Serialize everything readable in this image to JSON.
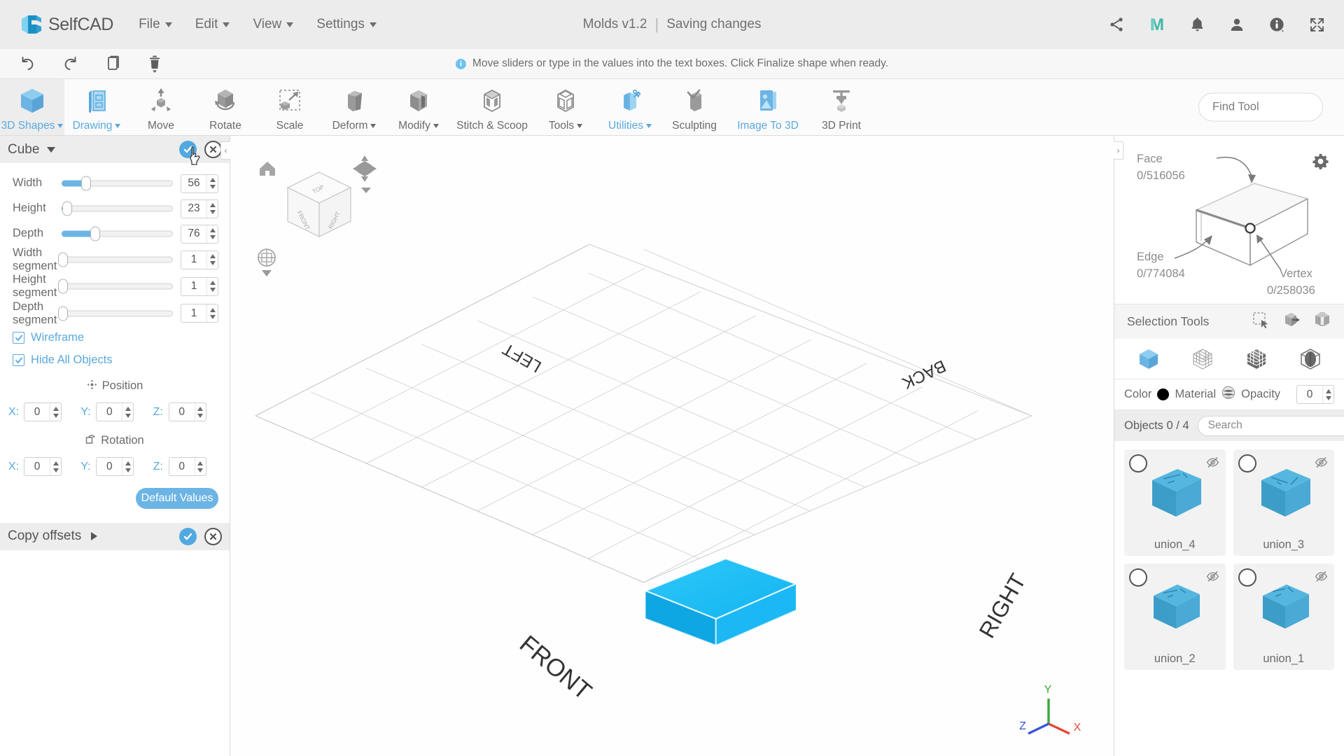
{
  "header": {
    "brand": "SelfCAD",
    "menus": [
      {
        "label": "File",
        "caret": true
      },
      {
        "label": "Edit",
        "caret": true
      },
      {
        "label": "View",
        "caret": true
      },
      {
        "label": "Settings",
        "caret": true
      }
    ],
    "document_title": "Molds v1.2",
    "separator": "|",
    "status": "Saving changes",
    "icons": [
      {
        "name": "share-icon"
      },
      {
        "name": "magicavoxel-m-icon"
      },
      {
        "name": "notifications-bell-icon"
      },
      {
        "name": "account-person-icon"
      },
      {
        "name": "info-icon"
      },
      {
        "name": "fullscreen-icon"
      }
    ]
  },
  "quickbar": {
    "buttons": [
      {
        "name": "undo-button",
        "label": "Undo"
      },
      {
        "name": "redo-button",
        "label": "Redo"
      },
      {
        "name": "copy-button",
        "label": "Copy"
      },
      {
        "name": "delete-button",
        "label": "Delete"
      }
    ],
    "hint": "Move sliders or type in the values into the text boxes. Click Finalize shape when ready."
  },
  "ribbon": {
    "tools": [
      {
        "label": "3D Shapes",
        "caret": true,
        "state": "active",
        "icon": "cube-blue-icon"
      },
      {
        "label": "Drawing",
        "caret": true,
        "state": "blue",
        "icon": "drawing-pencil-icon"
      },
      {
        "label": "Move",
        "caret": false,
        "state": "normal",
        "icon": "move-arrows-icon"
      },
      {
        "label": "Rotate",
        "caret": false,
        "state": "normal",
        "icon": "rotate-icon"
      },
      {
        "label": "Scale",
        "caret": false,
        "state": "normal",
        "icon": "scale-icon"
      },
      {
        "label": "Deform",
        "caret": true,
        "state": "normal",
        "icon": "deform-icon"
      },
      {
        "label": "Modify",
        "caret": true,
        "state": "normal",
        "icon": "modify-icon"
      },
      {
        "label": "Stitch & Scoop",
        "caret": false,
        "state": "normal",
        "icon": "stitch-scoop-icon"
      },
      {
        "label": "Tools",
        "caret": true,
        "state": "normal",
        "icon": "tools-icon"
      },
      {
        "label": "Utilities",
        "caret": true,
        "state": "blue",
        "icon": "utilities-scissors-icon"
      },
      {
        "label": "Sculpting",
        "caret": false,
        "state": "normal",
        "icon": "sculpting-icon"
      },
      {
        "label": "Image To 3D",
        "caret": false,
        "state": "blue",
        "icon": "image-to-3d-icon"
      },
      {
        "label": "3D Print",
        "caret": false,
        "state": "normal",
        "icon": "3d-print-icon"
      }
    ],
    "find_tool_placeholder": "Find Tool"
  },
  "left_panel": {
    "title": "Cube",
    "sliders": [
      {
        "label": "Width",
        "value": "56",
        "pct": 22
      },
      {
        "label": "Height",
        "value": "23",
        "pct": 5
      },
      {
        "label": "Depth",
        "value": "76",
        "pct": 30
      },
      {
        "label": "Width segment",
        "value": "1",
        "pct": 0
      },
      {
        "label": "Height segment",
        "value": "1",
        "pct": 0
      },
      {
        "label": "Depth segment",
        "value": "1",
        "pct": 0
      }
    ],
    "checkboxes": [
      {
        "label": "Wireframe",
        "checked": true
      },
      {
        "label": "Hide All Objects",
        "checked": true
      }
    ],
    "position": {
      "title": "Position",
      "x": "0",
      "y": "0",
      "z": "0",
      "x_label": "X:",
      "y_label": "Y:",
      "z_label": "Z:"
    },
    "rotation": {
      "title": "Rotation",
      "x": "0",
      "y": "0",
      "z": "0",
      "x_label": "X:",
      "y_label": "Y:",
      "z_label": "Z:"
    },
    "default_values_button": "Default Values",
    "copy_offsets": "Copy offsets"
  },
  "viewport": {
    "navcube_faces": {
      "top": "TOP",
      "front": "FRONT",
      "right": "RIGHT"
    },
    "ground_labels": {
      "left": "LEFT",
      "back": "BACK",
      "front": "FRONT",
      "right": "RIGHT"
    },
    "axis": {
      "x": "X",
      "y": "Y",
      "z": "Z",
      "x_color": "#e04a3a",
      "y_color": "#3aa83a",
      "z_color": "#3a51e0"
    },
    "shape_color": "#18bdf5"
  },
  "right_panel": {
    "mesh_info": {
      "face_label": "Face",
      "face_value": "0/516056",
      "edge_label": "Edge",
      "edge_value": "0/774084",
      "vertex_label": "Vertex",
      "vertex_value": "0/258036"
    },
    "selection_tools_label": "Selection Tools",
    "selection_tool_icons": [
      {
        "name": "rectangle-select-icon"
      },
      {
        "name": "box-select-through-icon"
      },
      {
        "name": "lasso-select-icon"
      }
    ],
    "mode_icons": [
      {
        "name": "object-mode-icon",
        "active": true
      },
      {
        "name": "vertex-mode-icon",
        "active": false
      },
      {
        "name": "face-mode-icon",
        "active": false
      },
      {
        "name": "edge-mode-icon",
        "active": false
      }
    ],
    "color_label": "Color",
    "color_value": "#000000",
    "material_label": "Material",
    "opacity_label": "Opacity",
    "opacity_value": "0",
    "objects_label": "Objects 0 / 4",
    "search_placeholder": "Search",
    "objects": [
      {
        "name": "union_4",
        "hidden": true,
        "selected": false
      },
      {
        "name": "union_3",
        "hidden": true,
        "selected": false
      },
      {
        "name": "union_2",
        "hidden": true,
        "selected": false
      },
      {
        "name": "union_1",
        "hidden": true,
        "selected": false
      }
    ]
  }
}
